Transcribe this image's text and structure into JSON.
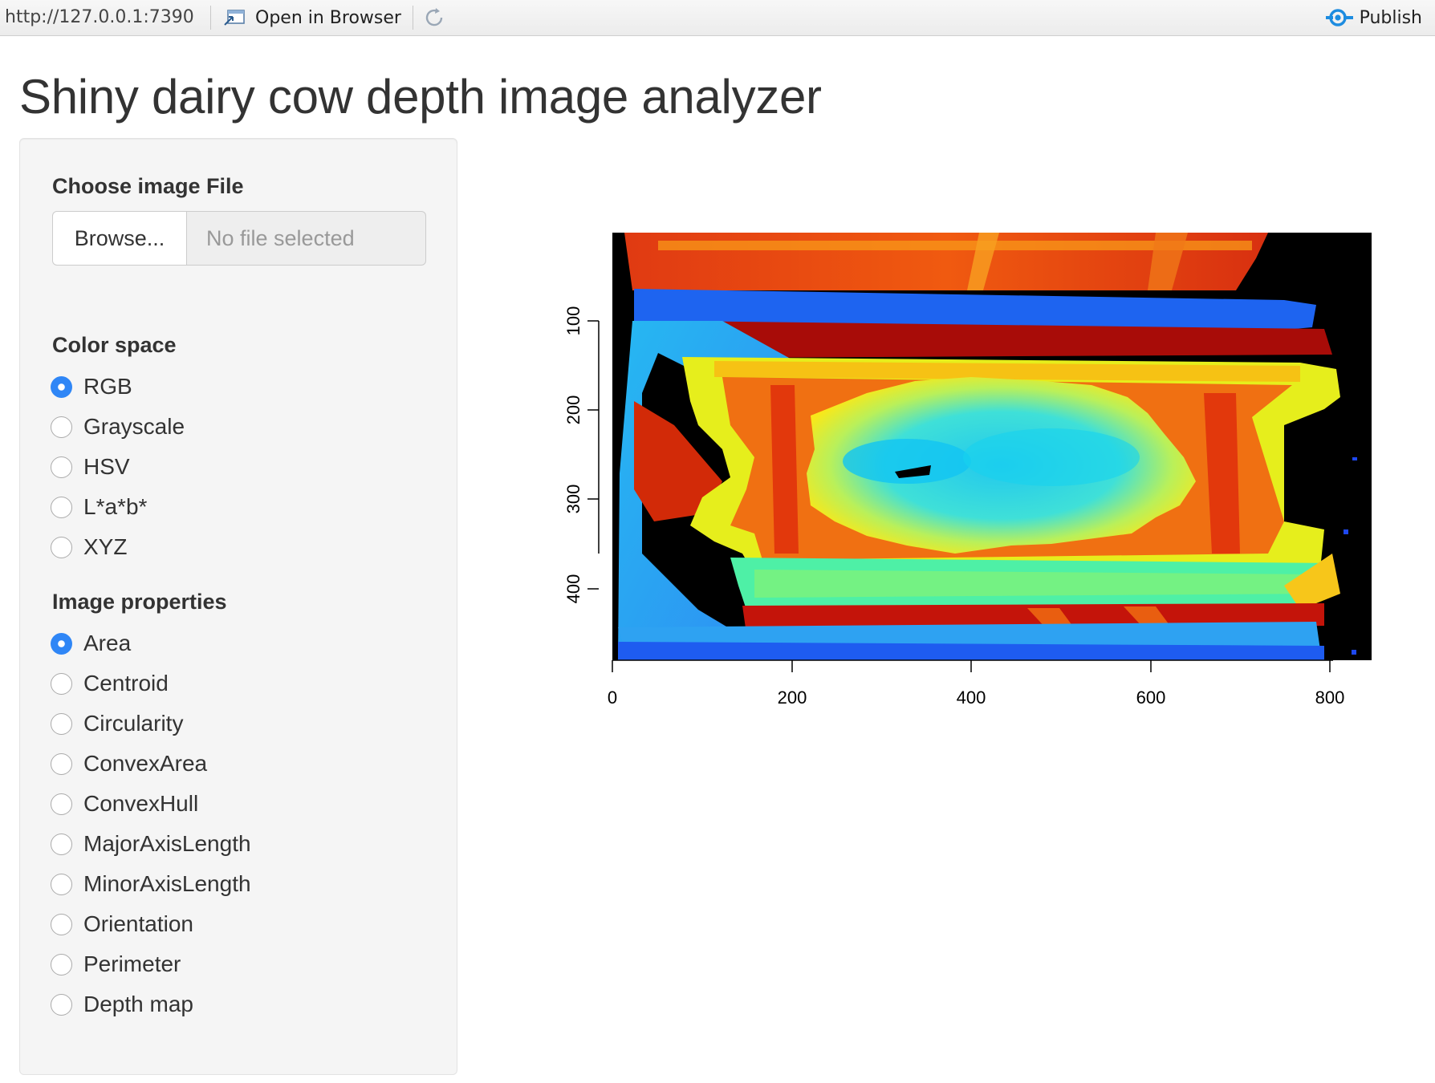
{
  "toolbar": {
    "url": "http://127.0.0.1:7390",
    "open_in_browser": "Open in Browser",
    "publish": "Publish"
  },
  "page": {
    "title": "Shiny dairy cow depth image analyzer"
  },
  "sidebar": {
    "file_input": {
      "label": "Choose image File",
      "browse_label": "Browse...",
      "placeholder": "No file selected"
    },
    "color_space": {
      "label": "Color space",
      "selected": "RGB",
      "options": [
        "RGB",
        "Grayscale",
        "HSV",
        "L*a*b*",
        "XYZ"
      ]
    },
    "image_properties": {
      "label": "Image properties",
      "selected": "Area",
      "options": [
        "Area",
        "Centroid",
        "Circularity",
        "ConvexArea",
        "ConvexHull",
        "MajorAxisLength",
        "MinorAxisLength",
        "Orientation",
        "Perimeter",
        "Depth map"
      ]
    }
  },
  "plot": {
    "x_ticks": [
      "0",
      "200",
      "400",
      "600",
      "800"
    ],
    "y_ticks": [
      "100",
      "200",
      "300",
      "400"
    ]
  },
  "icons": {
    "open": "open-in-browser-icon",
    "refresh": "refresh-icon",
    "publish": "publish-icon"
  },
  "colors": {
    "radio_checked": "#2f86f6",
    "publish_icon": "#1d8ce0"
  }
}
